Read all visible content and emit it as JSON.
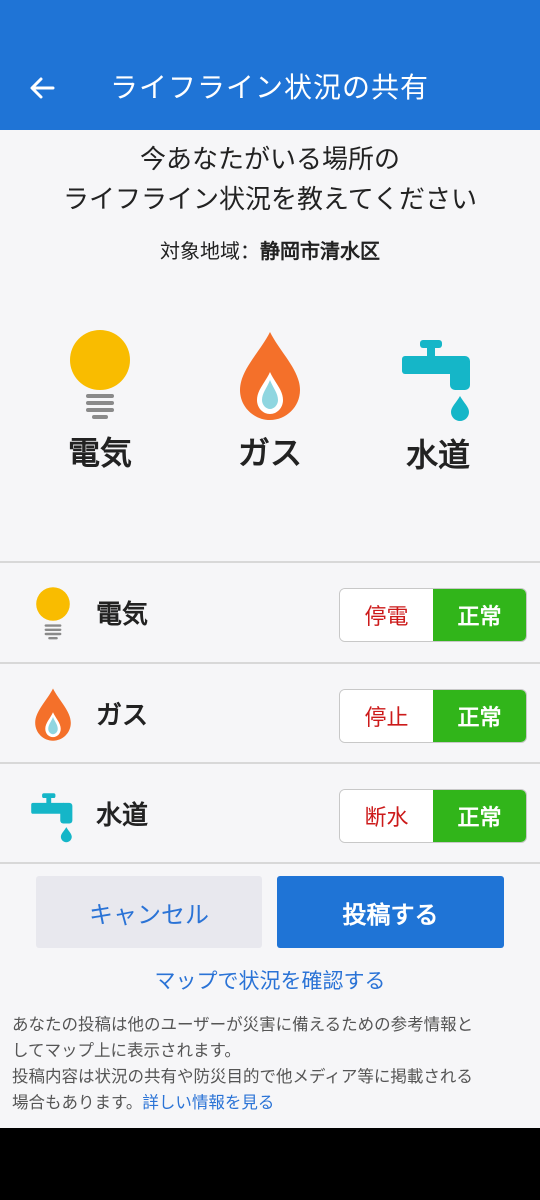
{
  "appbar": {
    "title": "ライフライン状況の共有",
    "back_icon": "arrow-left-icon"
  },
  "intro": {
    "line1": "今あなたがいる場所の",
    "line2": "ライフライン状況を教えてください",
    "region_label": "対象地域：",
    "region_value": "静岡市清水区"
  },
  "big_icons": [
    {
      "label": "電気",
      "icon": "lightbulb-icon"
    },
    {
      "label": "ガス",
      "icon": "flame-icon"
    },
    {
      "label": "水道",
      "icon": "faucet-icon"
    }
  ],
  "rows": [
    {
      "label": "電気",
      "icon": "lightbulb-icon",
      "off_label": "停電",
      "on_label": "正常",
      "selected": "正常"
    },
    {
      "label": "ガス",
      "icon": "flame-icon",
      "off_label": "停止",
      "on_label": "正常",
      "selected": "正常"
    },
    {
      "label": "水道",
      "icon": "faucet-icon",
      "off_label": "断水",
      "on_label": "正常",
      "selected": "正常"
    }
  ],
  "buttons": {
    "cancel": "キャンセル",
    "post": "投稿する"
  },
  "map_link": "マップで状況を確認する",
  "notice": {
    "line1": "あなたの投稿は他のユーザーが災害に備えるための参考情報と",
    "line2": "してマップ上に表示されます。",
    "line3": "投稿内容は状況の共有や防災目的で他メディア等に掲載される",
    "line4": "場合もあります。",
    "link": "詳しい情報を見る"
  },
  "colors": {
    "primary": "#1f74d6",
    "selected_green": "#31b51a",
    "off_red": "#cc1a1a",
    "bulb_yellow": "#f9bc00",
    "flame_orange": "#f4702a",
    "water_cyan": "#15b6c8"
  }
}
